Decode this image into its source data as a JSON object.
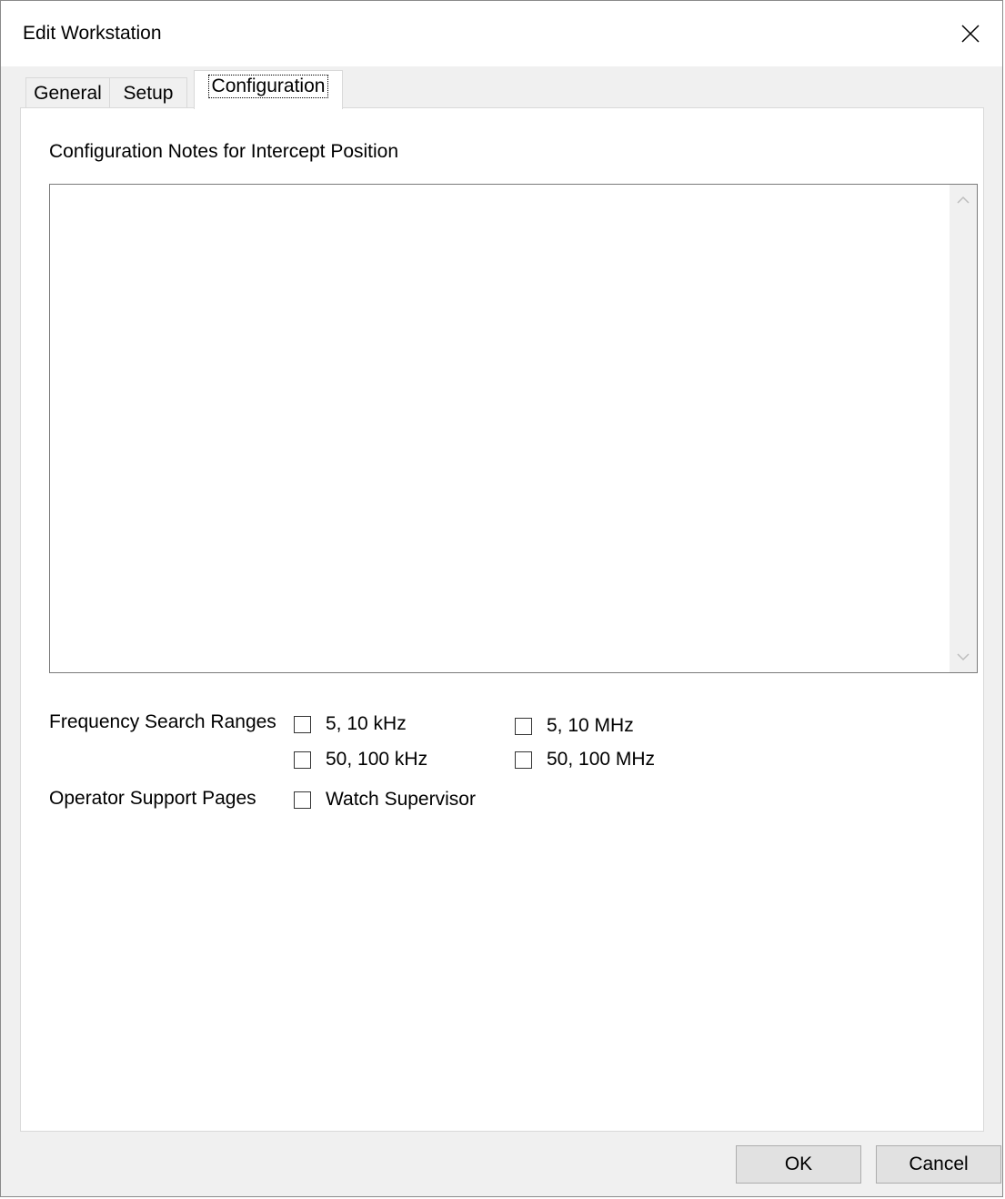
{
  "window": {
    "title": "Edit Workstation",
    "close_icon": "close-icon"
  },
  "tabs": [
    {
      "label": "General",
      "active": false
    },
    {
      "label": "Setup",
      "active": false
    },
    {
      "label": "Configuration",
      "active": true
    }
  ],
  "configuration": {
    "notes_label": "Configuration Notes for Intercept Position",
    "notes_value": "",
    "frequency_label": "Frequency Search Ranges",
    "frequency_options": [
      {
        "label": "5, 10 kHz",
        "checked": false
      },
      {
        "label": "5, 10 MHz",
        "checked": false
      },
      {
        "label": "50, 100 kHz",
        "checked": false
      },
      {
        "label": "50, 100 MHz",
        "checked": false
      }
    ],
    "operator_label": "Operator Support Pages",
    "operator_options": [
      {
        "label": "Watch Supervisor",
        "checked": false
      }
    ]
  },
  "footer": {
    "ok_label": "OK",
    "cancel_label": "Cancel"
  }
}
